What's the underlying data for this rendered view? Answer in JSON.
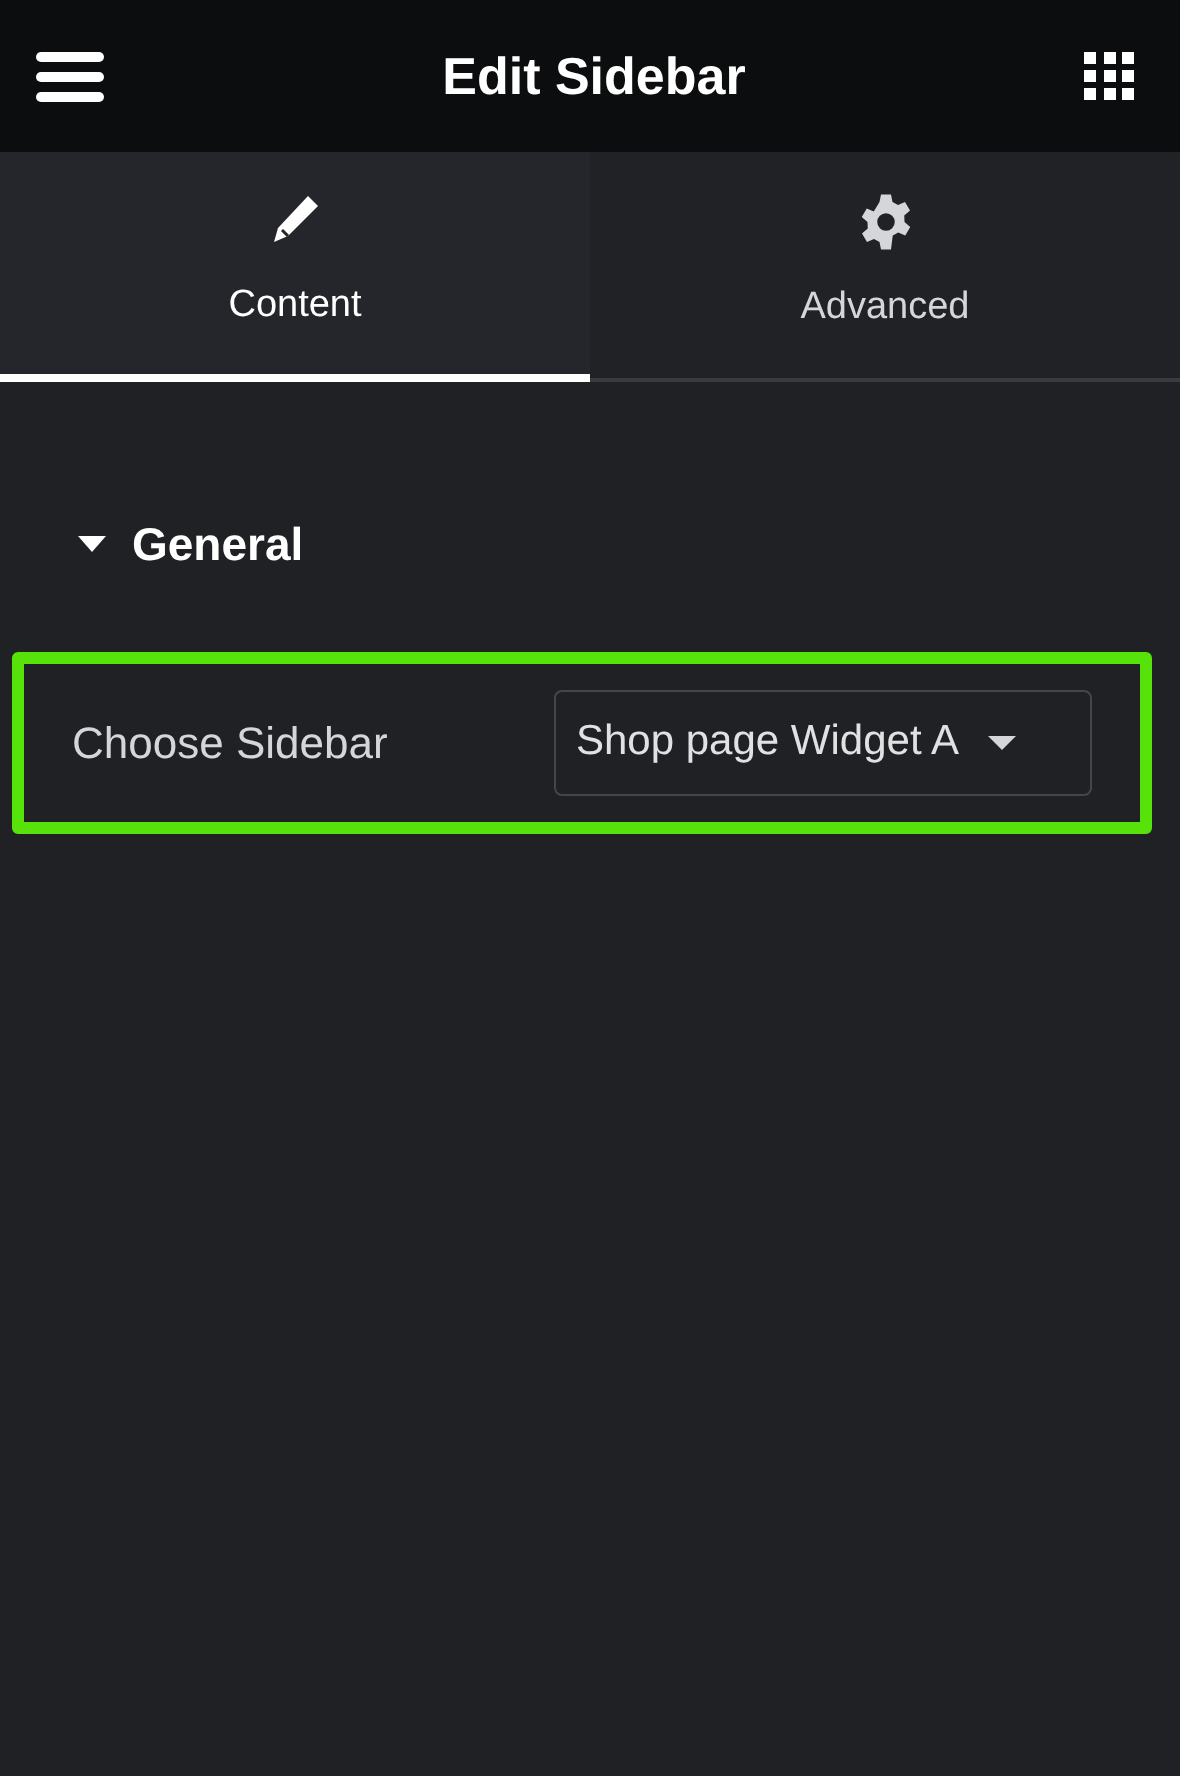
{
  "header": {
    "title": "Edit Sidebar"
  },
  "tabs": [
    {
      "label": "Content",
      "kind": "edit",
      "selected": true
    },
    {
      "label": "Advanced",
      "kind": "settings",
      "selected": false
    }
  ],
  "section": {
    "title": "General",
    "expanded": true,
    "controls": [
      {
        "label": "Choose Sidebar",
        "value": "Shop page Widget A",
        "highlighted": true
      }
    ]
  }
}
